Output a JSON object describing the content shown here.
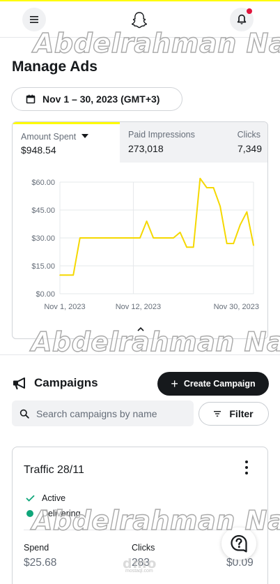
{
  "header": {
    "menu_icon": "hamburger-icon",
    "logo_icon": "snapchat-ghost-icon",
    "notification_icon": "bell-icon",
    "brand_color": "#fffc00",
    "notification_dot_color": "#e1143c"
  },
  "watermark": {
    "text": "Abdelrahman Nasr"
  },
  "page": {
    "title": "Manage Ads"
  },
  "date_range": {
    "icon": "calendar-icon",
    "label": "Nov 1 – 30, 2023 (GMT+3)"
  },
  "metrics": [
    {
      "label": "Amount Spent",
      "value": "$948.54",
      "active": true
    },
    {
      "label": "Paid Impressions",
      "value": "273,018",
      "active": false
    },
    {
      "label": "Clicks",
      "value": "7,349",
      "active": false
    }
  ],
  "chart_data": {
    "type": "line",
    "title": "",
    "xlabel": "",
    "ylabel": "",
    "x_tick_labels": [
      "Nov 1, 2023",
      "Nov 12, 2023",
      "Nov 30, 2023"
    ],
    "y_tick_labels": [
      "$0.00",
      "$15.00",
      "$30.00",
      "$45.00",
      "$60.00"
    ],
    "ylim": [
      0,
      60
    ],
    "xlim": [
      1,
      30
    ],
    "grid": true,
    "line_color": "#f5d800",
    "series": [
      {
        "x": [
          1,
          2,
          3,
          4,
          5,
          6,
          7,
          8,
          9,
          10,
          11,
          12,
          13,
          14,
          15,
          16,
          17,
          18,
          19,
          20,
          21,
          22,
          23,
          24,
          25,
          26,
          27,
          28,
          29,
          30
        ],
        "values": [
          10,
          10,
          10,
          30,
          30,
          30,
          30,
          30,
          30,
          30,
          30,
          30,
          30,
          39,
          30,
          30,
          30,
          30,
          33,
          25,
          25,
          62,
          57,
          57,
          47,
          27,
          27,
          37,
          44,
          26
        ]
      }
    ]
  },
  "campaigns": {
    "icon": "megaphone-icon",
    "title": "Campaigns",
    "create_button": "Create Campaign",
    "search_placeholder": "Search campaigns by name",
    "filter_label": "Filter",
    "filter_icon": "filter-lines-icon",
    "card": {
      "name": "Traffic 28/11",
      "status_items": [
        {
          "icon": "check-icon",
          "label": "Active",
          "color": "#0fa67a"
        },
        {
          "icon": "green-dot-icon",
          "label": "Delivering",
          "color": "#0fa67a"
        }
      ],
      "stats": [
        {
          "label": "Spend",
          "value": "$25.68"
        },
        {
          "label": "Clicks",
          "value": "283"
        },
        {
          "label": "",
          "value": "$0.09"
        }
      ]
    }
  },
  "help": {
    "icon": "help-question-icon"
  },
  "footer_logo": {
    "text": "dmo",
    "sub": "mostaql.com"
  }
}
